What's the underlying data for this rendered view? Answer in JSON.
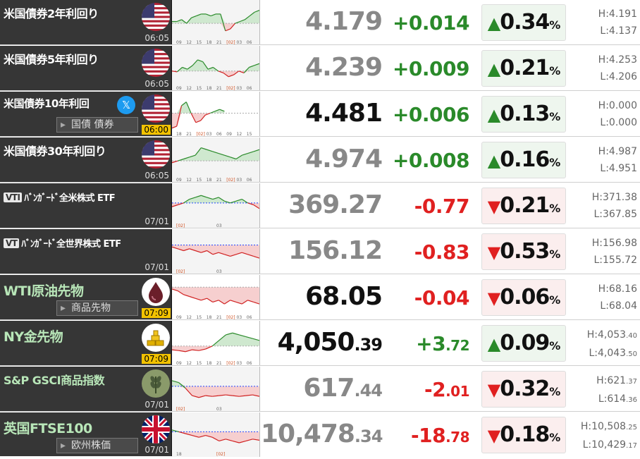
{
  "rows": [
    {
      "name": "米国債券2年利回り",
      "time": "06:05",
      "price": "4.179",
      "change": "+0.014",
      "dir": "up",
      "pct": "0.34",
      "high": "H:4.191",
      "low": "L:4.137",
      "icon": "us-flag-icon"
    },
    {
      "name": "米国債券5年利回り",
      "time": "06:05",
      "price": "4.239",
      "change": "+0.009",
      "dir": "up",
      "pct": "0.21",
      "high": "H:4.253",
      "low": "L:4.206",
      "icon": "us-flag-icon"
    },
    {
      "name": "米国債券10年利回",
      "time": "06:00",
      "price": "4.481",
      "change": "+0.006",
      "dir": "up",
      "pct": "0.13",
      "high": "H:0.000",
      "low": "L:0.000",
      "icon": "us-flag-icon",
      "sub": "国債 債券"
    },
    {
      "name": "米国債券30年利回り",
      "time": "06:05",
      "price": "4.974",
      "change": "+0.008",
      "dir": "up",
      "pct": "0.16",
      "high": "H:4.987",
      "low": "L:4.951",
      "icon": "us-flag-icon"
    },
    {
      "name": "ﾊﾞﾝｶﾞｰﾄﾞ全米株式 ETF",
      "tag": "VTI",
      "time": "07/01",
      "price": "369.27",
      "change": "-0.77",
      "dir": "down",
      "pct": "0.21",
      "high": "H:371.38",
      "low": "L:367.85"
    },
    {
      "name": "ﾊﾞﾝｶﾞｰﾄﾞ全世界株式 ETF",
      "tag": "VT",
      "time": "07/01",
      "price": "156.12",
      "change": "-0.83",
      "dir": "down",
      "pct": "0.53",
      "high": "H:156.98",
      "low": "L:155.72"
    },
    {
      "name": "WTI原油先物",
      "time": "07:09",
      "price": "68.05",
      "change": "-0.04",
      "dir": "down",
      "pct": "0.06",
      "high": "H:68.16",
      "low": "L:68.04",
      "icon": "oil-drop-icon",
      "sub": "商品先物"
    },
    {
      "name": "NY金先物",
      "time": "07:09",
      "price_main": "4,050",
      "price_dec": ".39",
      "change_main": "+3",
      "change_dec": ".72",
      "dir": "up",
      "pct": "0.09",
      "high_main": "H:4,053",
      "high_dec": ".40",
      "low_main": "L:4,043",
      "low_dec": ".50",
      "icon": "gold-bars-icon"
    },
    {
      "name": "S&P GSCI商品指数",
      "time": "07/01",
      "price_main": "617",
      "price_dec": ".44",
      "change_main": "-2",
      "change_dec": ".01",
      "dir": "down",
      "pct": "0.32",
      "high_main": "H:621",
      "high_dec": ".37",
      "low_main": "L:614",
      "low_dec": ".36",
      "icon": "wheat-icon"
    },
    {
      "name": "英国FTSE100",
      "time": "07/01",
      "price_main": "10,478",
      "price_dec": ".34",
      "change_main": "-18",
      "change_dec": ".78",
      "dir": "down",
      "pct": "0.18",
      "high_main": "H:10,508",
      "high_dec": ".25",
      "low_main": "L:10,429",
      "low_dec": ".17",
      "icon": "uk-flag-icon",
      "sub": "欧州株価"
    }
  ],
  "pct_sign": "%",
  "up_arrow": "▲",
  "down_arrow": "▼",
  "chart_labels": {
    "a": [
      "09",
      "12",
      "15",
      "18",
      "21",
      "[02]",
      "03",
      "06"
    ],
    "b": [
      "18",
      "21",
      "[02]",
      "03",
      "06",
      "09",
      "12",
      "15"
    ],
    "c": [
      "[02]",
      "03"
    ],
    "d": [
      "18",
      "[02]"
    ]
  }
}
